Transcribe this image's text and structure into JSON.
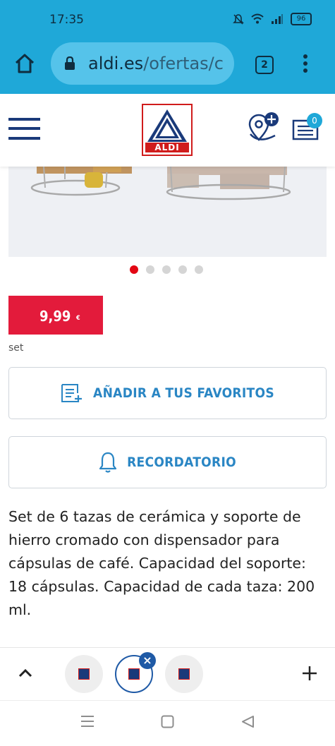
{
  "status": {
    "time": "17:35",
    "battery": "96"
  },
  "browser": {
    "url_host": "aldi.es",
    "url_path": "/ofertas/c",
    "tab_count": "2"
  },
  "header": {
    "logo_text": "ALDI",
    "cart_count": "0"
  },
  "carousel": {
    "dot_count": 5,
    "active_index": 0
  },
  "product": {
    "price": "9,99",
    "currency": "€",
    "unit": "set",
    "favorites_label": "AÑADIR A TUS FAVORITOS",
    "reminder_label": "RECORDATORIO",
    "description": "Set de 6 tazas de cerámica y soporte de hierro cromado con dispensador para cápsulas de café. Capacidad del soporte: 18 cápsulas. Capacidad de cada taza: 200 ml."
  },
  "tabbar": {
    "close_icon": "close-icon",
    "add_icon": "plus-icon"
  },
  "colors": {
    "chrome": "#1fa8d8",
    "price_red": "#e31b3b",
    "action_blue": "#2a86c4",
    "aldi_navy": "#1a3a7a",
    "aldi_red": "#d01c1c"
  }
}
